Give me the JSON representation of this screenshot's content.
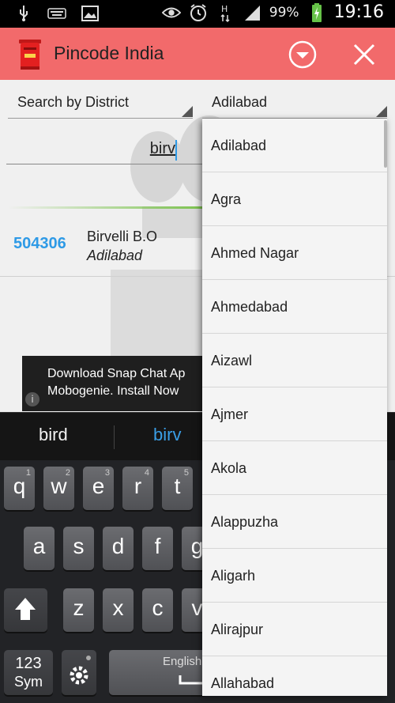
{
  "status_bar": {
    "battery": "99%",
    "time": "19:16",
    "icons": [
      "usb-icon",
      "keyboard-icon",
      "image-icon",
      "eye-icon",
      "alarm-icon",
      "hplus-icon",
      "signal-icon",
      "battery-charging-icon"
    ]
  },
  "app_bar": {
    "title": "Pincode India",
    "accent": "#f26a6b"
  },
  "filters": {
    "search_by": "Search by District",
    "district": "Adilabad"
  },
  "search": {
    "value": "birv"
  },
  "results": [
    {
      "pincode": "504306",
      "office": "Birvelli B.O",
      "district": "Adilabad"
    }
  ],
  "ad": {
    "line1": "Download Snap Chat Ap",
    "line2": "Mobogenie. Install Now",
    "info_label": "i"
  },
  "suggestions": {
    "left": "bird",
    "right": "birv"
  },
  "keyboard": {
    "row1": [
      {
        "ch": "q",
        "hint": "1"
      },
      {
        "ch": "w",
        "hint": "2"
      },
      {
        "ch": "e",
        "hint": "3"
      },
      {
        "ch": "r",
        "hint": "4"
      },
      {
        "ch": "t",
        "hint": "5"
      }
    ],
    "row2": [
      {
        "ch": "a"
      },
      {
        "ch": "s"
      },
      {
        "ch": "d"
      },
      {
        "ch": "f"
      },
      {
        "ch": "g"
      }
    ],
    "row3": [
      {
        "ch": "z"
      },
      {
        "ch": "x"
      },
      {
        "ch": "c"
      },
      {
        "ch": "v"
      }
    ],
    "sym_top": "123",
    "sym_bottom": "Sym",
    "space_label": "English"
  },
  "dropdown": {
    "items": [
      "Adilabad",
      "Agra",
      "Ahmed Nagar",
      "Ahmedabad",
      "Aizawl",
      "Ajmer",
      "Akola",
      "Alappuzha",
      "Aligarh",
      "Alirajpur",
      "Allahabad"
    ]
  }
}
